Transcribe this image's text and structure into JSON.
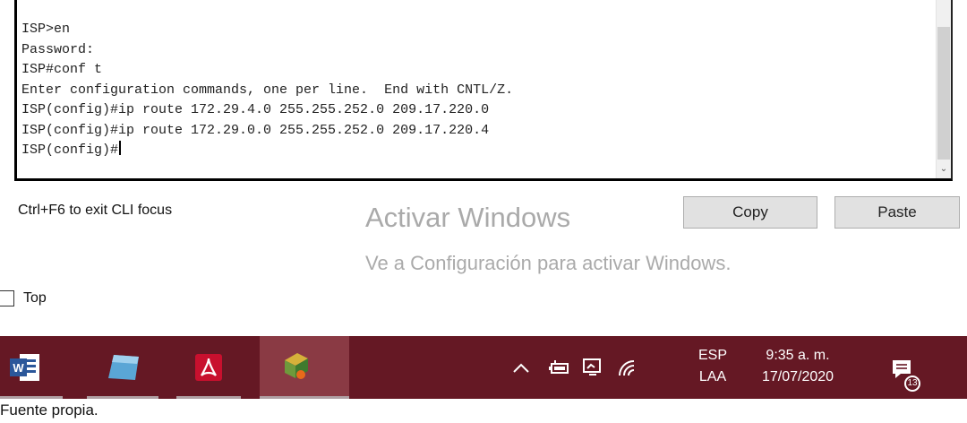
{
  "cli": {
    "lines": [
      "ISP>en",
      "Password:",
      "ISP#conf t",
      "Enter configuration commands, one per line.  End with CNTL/Z.",
      "ISP(config)#ip route 172.29.4.0 255.255.252.0 209.17.220.0",
      "ISP(config)#ip route 172.29.0.0 255.255.252.0 209.17.220.4",
      "ISP(config)#"
    ]
  },
  "controls": {
    "hint": "Ctrl+F6 to exit CLI focus",
    "copy_label": "Copy",
    "paste_label": "Paste",
    "top_label": "Top"
  },
  "watermark": {
    "line1": "Activar Windows",
    "line2": "Ve a Configuración para activar Windows."
  },
  "taskbar": {
    "apps": [
      "word-icon",
      "app-icon",
      "acrobat-icon",
      "packet-tracer-icon"
    ],
    "lang_top": "ESP",
    "lang_bottom": "LAA",
    "time": "9:35 a. m.",
    "date": "17/07/2020",
    "notification_count": "13",
    "color": "#651824"
  },
  "caption": "Fuente propia."
}
